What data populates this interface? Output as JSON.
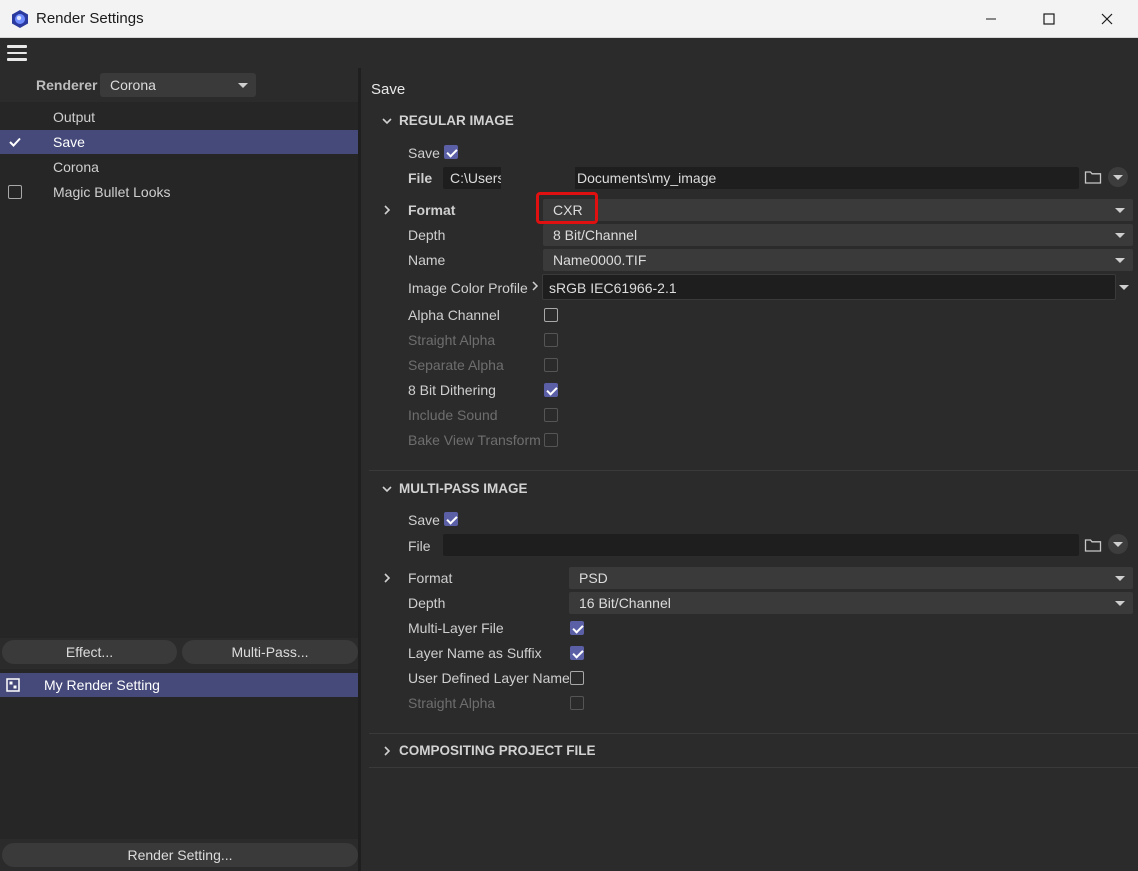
{
  "window": {
    "title": "Render Settings",
    "icon": "cinema4d-app-icon",
    "controls": [
      "minimize-icon",
      "maximize-icon",
      "close-icon"
    ]
  },
  "menu": {
    "icon": "hamburger-menu-icon"
  },
  "left": {
    "renderer_label": "Renderer",
    "renderer_value": "Corona",
    "items": [
      {
        "label": "Output",
        "checkbox": "none",
        "selected": false
      },
      {
        "label": "Save",
        "checkbox": "checked",
        "selected": true
      },
      {
        "label": "Corona",
        "checkbox": "none",
        "selected": false
      },
      {
        "label": "Magic Bullet Looks",
        "checkbox": "unchecked",
        "selected": false
      }
    ],
    "effect_button": "Effect...",
    "multipass_button": "Multi-Pass...",
    "render_setting_item": "My Render Setting",
    "render_setting_button": "Render Setting..."
  },
  "right": {
    "title": "Save",
    "regular": {
      "heading": "REGULAR IMAGE",
      "save_label": "Save",
      "save_checked": true,
      "file_label": "File",
      "file_value_start": "C:\\Users",
      "file_value_end": "Documents\\my_image",
      "format_label": "Format",
      "format_value": "CXR",
      "depth_label": "Depth",
      "depth_value": "8 Bit/Channel",
      "name_label": "Name",
      "name_value": "Name0000.TIF",
      "profile_label": "Image Color Profile",
      "profile_value": "sRGB IEC61966-2.1",
      "options": [
        {
          "label": "Alpha Channel",
          "checked": false,
          "enabled": true
        },
        {
          "label": "Straight Alpha",
          "checked": false,
          "enabled": false
        },
        {
          "label": "Separate Alpha",
          "checked": false,
          "enabled": false
        },
        {
          "label": "8 Bit Dithering",
          "checked": true,
          "enabled": true
        },
        {
          "label": "Include Sound",
          "checked": false,
          "enabled": false
        },
        {
          "label": "Bake View Transform",
          "checked": false,
          "enabled": false
        }
      ]
    },
    "multipass": {
      "heading": "MULTI-PASS IMAGE",
      "save_label": "Save",
      "save_checked": true,
      "file_label": "File",
      "file_value": "",
      "format_label": "Format",
      "format_value": "PSD",
      "depth_label": "Depth",
      "depth_value": "16 Bit/Channel",
      "options": [
        {
          "label": "Multi-Layer File",
          "checked": true,
          "enabled": true
        },
        {
          "label": "Layer Name as Suffix",
          "checked": true,
          "enabled": true
        },
        {
          "label": "User Defined Layer Name",
          "checked": false,
          "enabled": true
        },
        {
          "label": "Straight Alpha",
          "checked": false,
          "enabled": false
        }
      ]
    },
    "compositing": {
      "heading": "COMPOSITING PROJECT FILE"
    }
  },
  "colors": {
    "accent": "#464a7a",
    "checkbox_on": "#5b5fa6",
    "highlight_box": "#e01010",
    "background": "#2b2b2b"
  }
}
